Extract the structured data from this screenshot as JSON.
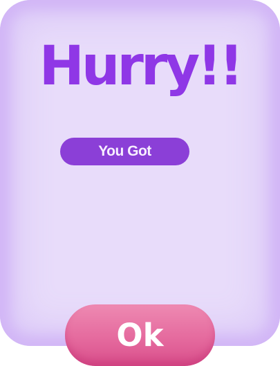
{
  "dialog": {
    "title": "Hurry!!",
    "badge_label": "You Got"
  },
  "actions": {
    "ok_label": "Ok"
  },
  "colors": {
    "panel": "#e8dcfa",
    "title": "#8f37e6",
    "badge": "#8b3fd7",
    "ok_button": "#e56a9e"
  }
}
